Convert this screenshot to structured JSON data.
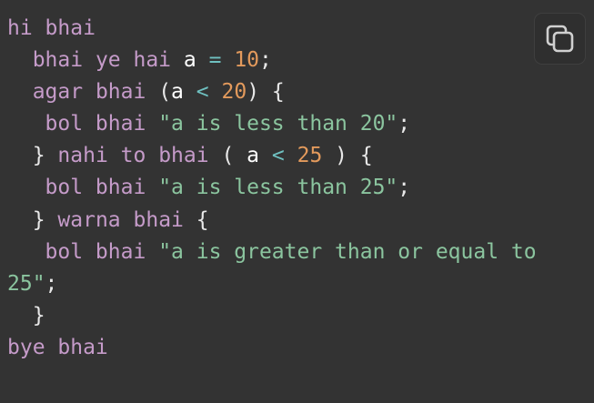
{
  "code": {
    "line1": {
      "kw": "hi bhai"
    },
    "line2": {
      "indent": "  ",
      "kw": "bhai ye hai",
      "var": "a",
      "op": "=",
      "num": "10",
      "end": ";"
    },
    "line3": {
      "indent": "  ",
      "kw": "agar bhai",
      "open": "(",
      "var": "a",
      "op": "<",
      "num": "20",
      "close": ") {"
    },
    "line4": {
      "indent": "   ",
      "kw": "bol bhai",
      "str": "\"a is less than 20\"",
      "end": ";"
    },
    "line5": {
      "indent": "  ",
      "close": "}",
      "kw": "nahi to bhai",
      "open": "(",
      "var": "a",
      "op": "<",
      "num": "25",
      "end": ") {"
    },
    "line6": {
      "indent": "   ",
      "kw": "bol bhai",
      "str": "\"a is less than 25\"",
      "end": ";"
    },
    "line7": {
      "indent": "  ",
      "close": "}",
      "kw": "warna bhai",
      "open": "{"
    },
    "line8": {
      "indent": "   ",
      "kw": "bol bhai",
      "str": "\"a is greater than or equal to 25\"",
      "end": ";"
    },
    "line9": {
      "indent": "  ",
      "close": "}"
    },
    "line10": {
      "kw": "bye bhai"
    }
  },
  "copy_button": {
    "icon": "copy-icon"
  }
}
